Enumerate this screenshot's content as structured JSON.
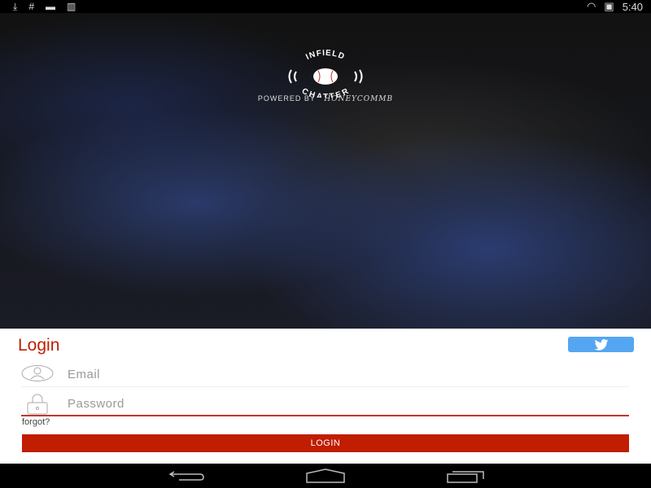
{
  "status_bar": {
    "time": "5:40",
    "icons": [
      "download-icon",
      "hash-icon",
      "card-icon",
      "barcode-icon",
      "wifi-icon",
      "battery-icon"
    ]
  },
  "hero": {
    "logo_top": "INFIELD",
    "logo_bottom": "CHATTER",
    "powered_by": "POWERED BY",
    "powered_brand": "HONEYCOMMB"
  },
  "login": {
    "title": "Login",
    "email_placeholder": "Email",
    "password_placeholder": "Password",
    "forgot": "forgot?",
    "login_button": "LOGIN"
  },
  "colors": {
    "accent": "#c11d00",
    "twitter": "#55a6f2"
  }
}
